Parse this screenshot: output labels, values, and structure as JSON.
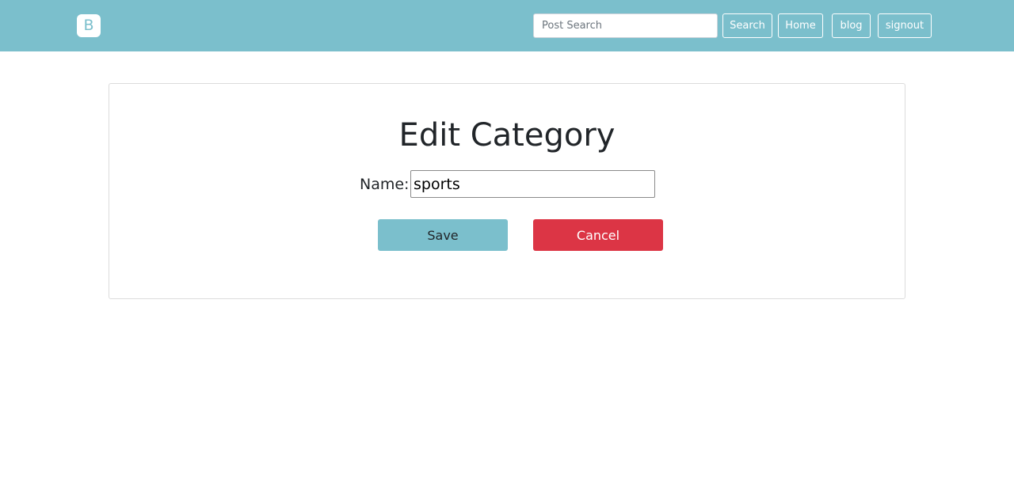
{
  "navbar": {
    "brand_letter": "B",
    "search_placeholder": "Post Search",
    "search_value": "",
    "search_button": "Search",
    "home_button": "Home",
    "blog_button": "blog",
    "signout_button": "signout",
    "background_color": "#7bbfcc"
  },
  "form": {
    "title": "Edit Category",
    "name_label": "Name:",
    "name_value": "sports",
    "save_label": "Save",
    "cancel_label": "Cancel",
    "save_color": "#7bbfcc",
    "cancel_color": "#dc3545"
  }
}
